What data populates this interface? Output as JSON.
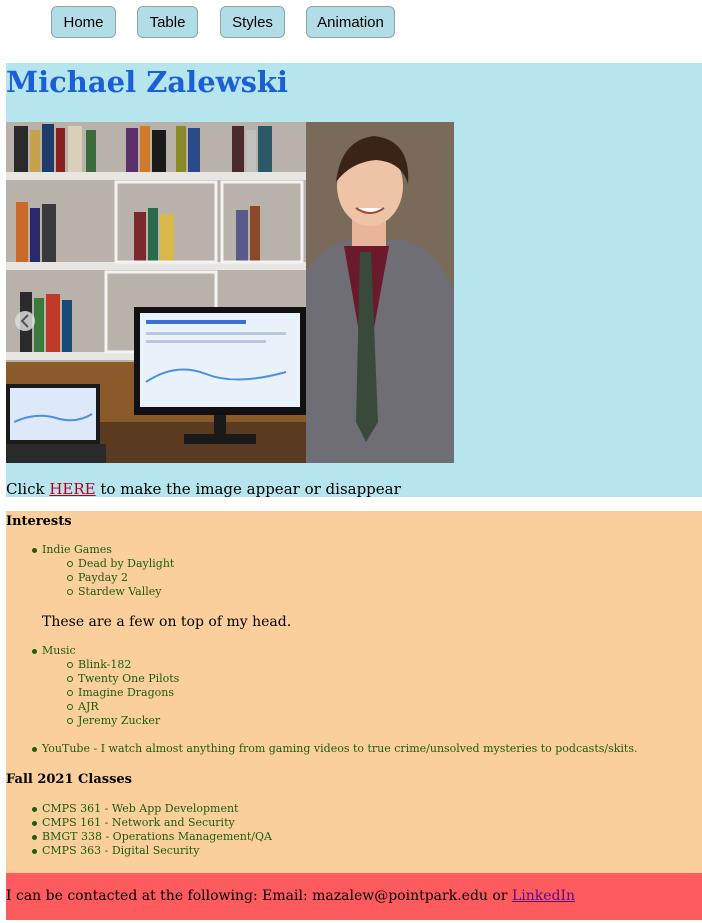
{
  "nav": [
    "Home",
    "Table",
    "Styles",
    "Animation"
  ],
  "hero": {
    "name": "Michael Zalewski",
    "toggle_prefix": "Click ",
    "toggle_link": "HERE",
    "toggle_suffix": " to make the image appear or disappear"
  },
  "interests": {
    "title": "Interests",
    "games": {
      "label": "Indie Games",
      "items": [
        "Dead by Daylight",
        "Payday 2",
        "Stardew Valley"
      ]
    },
    "note": "These are a few on top of my head.",
    "music": {
      "label": "Music",
      "items": [
        "Blink-182",
        "Twenty One Pilots",
        "Imagine Dragons",
        "AJR",
        "Jeremy Zucker"
      ]
    },
    "youtube": "YouTube - I watch almost anything from gaming videos to true crime/unsolved mysteries to podcasts/skits."
  },
  "classes": {
    "title": "Fall 2021 Classes",
    "items": [
      "CMPS 361 - Web App Development",
      "CMPS 161 - Network and Security",
      "BMGT 338 - Operations Management/QA",
      "CMPS 363 - Digital Security"
    ]
  },
  "contact": {
    "prefix": "I can be contacted at the following: Email: mazalew@pointpark.edu or ",
    "link": "LinkedIn"
  },
  "colors": {
    "hero_bg": "#b7e5ee",
    "interests_bg": "#fbcf9c",
    "contact_bg": "#fe5b5e",
    "name": "#1a5fd6",
    "list_text": "#1c5c12"
  }
}
